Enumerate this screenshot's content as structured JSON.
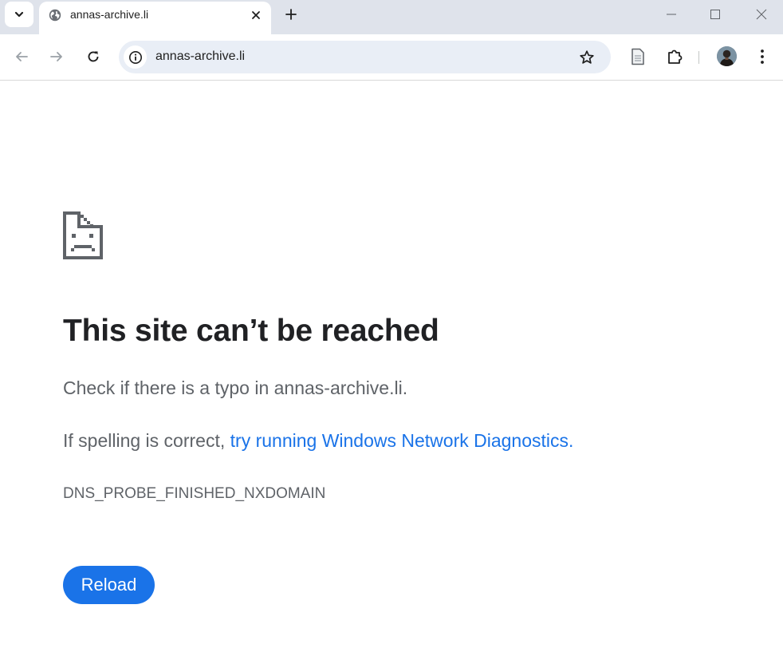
{
  "tab": {
    "title": "annas-archive.li"
  },
  "omnibox": {
    "url": "annas-archive.li"
  },
  "error": {
    "heading": "This site can’t be reached",
    "line1": "Check if there is a typo in annas-archive.li.",
    "line2_prefix": "If spelling is correct, ",
    "line2_link": "try running Windows Network Diagnostics.",
    "code": "DNS_PROBE_FINISHED_NXDOMAIN",
    "reload_label": "Reload"
  },
  "icons": {
    "tab_search": "chevron-down-icon",
    "favicon": "globe-icon",
    "tab_close": "close-icon",
    "new_tab": "plus-icon",
    "minimize": "minimize-icon",
    "maximize": "maximize-icon",
    "window_close": "close-icon",
    "back": "back-arrow-icon",
    "forward": "forward-arrow-icon",
    "reload": "reload-icon",
    "site_info": "info-icon",
    "bookmark": "star-icon",
    "reading_mode": "document-icon",
    "extensions": "puzzle-icon",
    "profile": "avatar",
    "menu": "kebab-menu-icon",
    "error": "sad-document-icon"
  },
  "colors": {
    "tabstrip_bg": "#dfe3eb",
    "omnibox_bg": "#e9eef6",
    "heading": "#202124",
    "body_text": "#5f6368",
    "link": "#1a73e8",
    "button_bg": "#1a73e8"
  }
}
